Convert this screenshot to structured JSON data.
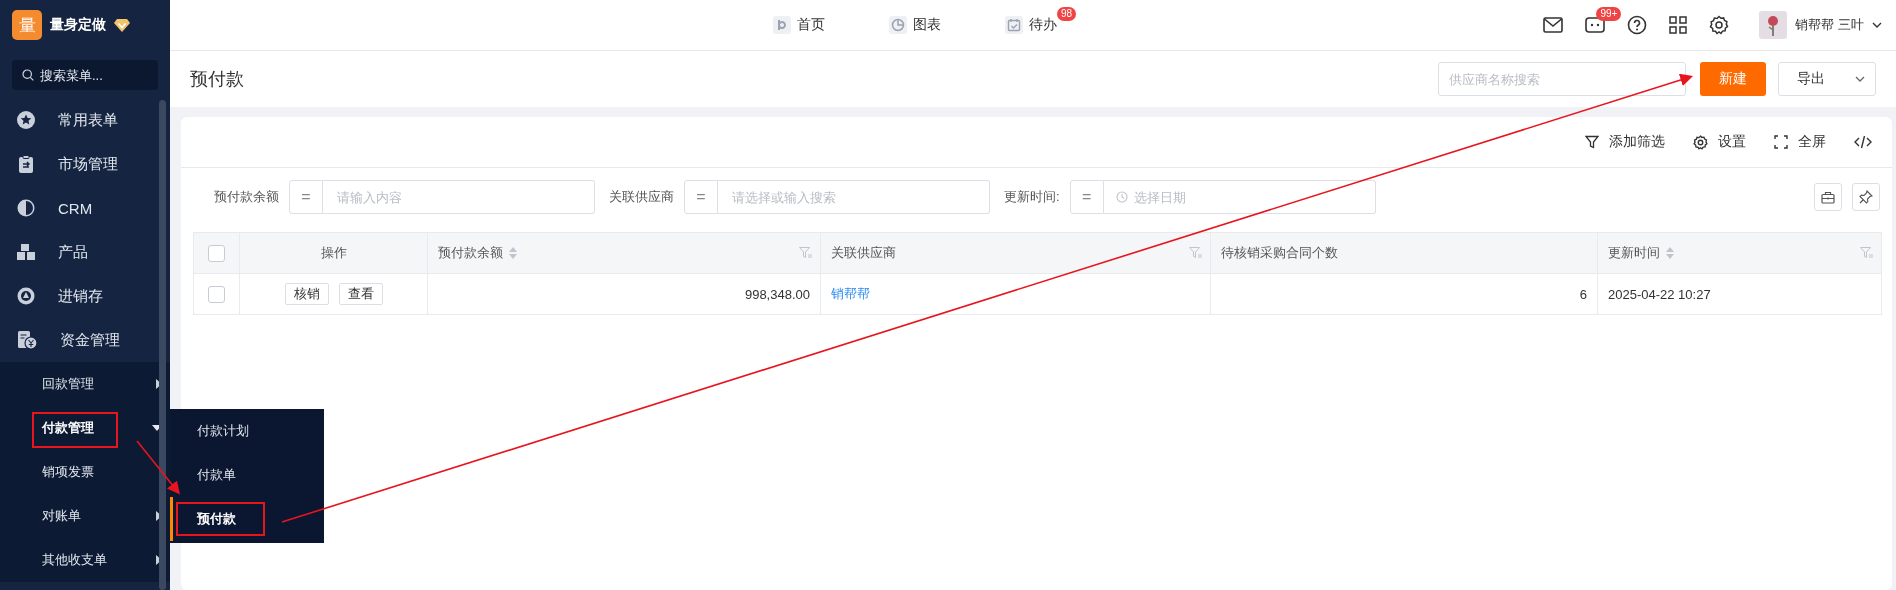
{
  "brand": {
    "logo": "量",
    "name": "量身定做"
  },
  "menu_search": {
    "placeholder": "搜索菜单..."
  },
  "sidebar": {
    "items": [
      {
        "label": "常用表单"
      },
      {
        "label": "市场管理"
      },
      {
        "label": "CRM"
      },
      {
        "label": "产品"
      },
      {
        "label": "进销存"
      },
      {
        "label": "资金管理",
        "children": [
          {
            "label": "回款管理",
            "kind": "group",
            "expanded": false
          },
          {
            "label": "付款管理",
            "kind": "group",
            "expanded": true
          },
          {
            "label": "销项发票",
            "kind": "link"
          },
          {
            "label": "对账单",
            "kind": "group",
            "expanded": false
          },
          {
            "label": "其他收支单",
            "kind": "group",
            "expanded": false
          }
        ]
      }
    ]
  },
  "flyout_menu": {
    "items": [
      {
        "label": "付款计划",
        "selected": false
      },
      {
        "label": "付款单",
        "selected": false
      },
      {
        "label": "预付款",
        "selected": true
      }
    ]
  },
  "top_nav": {
    "tabs": [
      {
        "label": "首页"
      },
      {
        "label": "图表"
      },
      {
        "label": "待办",
        "badge": "98"
      }
    ]
  },
  "top_actions": {
    "chat_badge": "99+",
    "user_name": "销帮帮 三叶"
  },
  "page": {
    "title": "预付款",
    "search": {
      "placeholder": "供应商名称搜索"
    },
    "buttons": [
      {
        "label": "新建",
        "kind": "primary"
      },
      {
        "label": "导出",
        "kind": "dropdown"
      }
    ]
  },
  "toolbar": {
    "items": [
      {
        "label": "添加筛选",
        "kind": "filter"
      },
      {
        "label": "设置",
        "kind": "settings"
      },
      {
        "label": "全屏",
        "kind": "fullscreen"
      }
    ]
  },
  "filters": [
    {
      "label": "预付款余额",
      "operator": "=",
      "placeholder": "请输入内容",
      "kind": "text"
    },
    {
      "label": "关联供应商",
      "operator": "=",
      "placeholder": "请选择或输入搜索",
      "kind": "text"
    },
    {
      "label": "更新时间:",
      "operator": "=",
      "placeholder": "选择日期",
      "kind": "date"
    }
  ],
  "table": {
    "all_checked": false,
    "columns": [
      {
        "label": "操作",
        "sortable": false,
        "filterable": false
      },
      {
        "label": "预付款余额",
        "sortable": true,
        "filterable": true
      },
      {
        "label": "关联供应商",
        "sortable": false,
        "filterable": true
      },
      {
        "label": "待核销采购合同个数",
        "sortable": false,
        "filterable": false
      },
      {
        "label": "更新时间",
        "sortable": true,
        "filterable": true
      }
    ],
    "rows": [
      {
        "checked": false,
        "cells": [
          {
            "kind": "actions",
            "actions": [
              "核销",
              "查看"
            ]
          },
          {
            "text": "998,348.00",
            "kind": "number"
          },
          {
            "text": "销帮帮",
            "kind": "link"
          },
          {
            "text": "6",
            "kind": "number"
          },
          {
            "text": "2025-04-22 10:27",
            "kind": "text"
          }
        ]
      }
    ]
  }
}
